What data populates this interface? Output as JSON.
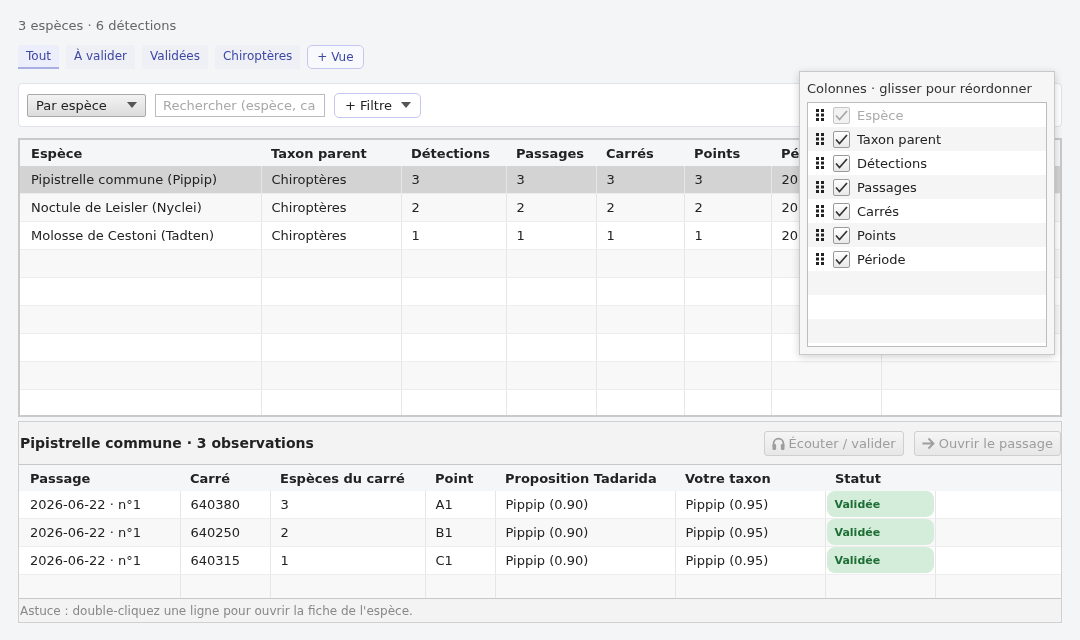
{
  "summary": "3 espèces · 6 détections",
  "tabs": [
    {
      "label": "Tout",
      "selected": true
    },
    {
      "label": "À valider",
      "selected": false
    },
    {
      "label": "Validées",
      "selected": false
    },
    {
      "label": "Chiroptères",
      "selected": false
    }
  ],
  "add_view_button": "+ Vue",
  "toolbar": {
    "group_by": "Par espèce",
    "search": {
      "placeholder": "Rechercher (espèce, ca"
    },
    "filter_button": "+ Filtre"
  },
  "species_table": {
    "columns": [
      "Espèce",
      "Taxon parent",
      "Détections",
      "Passages",
      "Carrés",
      "Points",
      "Pé"
    ],
    "rows": [
      {
        "cells": [
          "Pipistrelle commune (Pippip)",
          "Chiroptères",
          "3",
          "3",
          "3",
          "3",
          "20"
        ],
        "selected": true
      },
      {
        "cells": [
          "Noctule de Leisler (Nyclei)",
          "Chiroptères",
          "2",
          "2",
          "2",
          "2",
          "20"
        ],
        "selected": false
      },
      {
        "cells": [
          "Molosse de Cestoni (Tadten)",
          "Chiroptères",
          "1",
          "1",
          "1",
          "1",
          "20"
        ],
        "selected": false
      }
    ]
  },
  "detail": {
    "title": "Pipistrelle commune · 3 observations",
    "listen_button": {
      "label": "Écouter / valider",
      "disabled": true
    },
    "open_button": {
      "label": "Ouvrir le passage",
      "disabled": true
    },
    "columns": [
      "Passage",
      "Carré",
      "Espèces du carré",
      "Point",
      "Proposition Tadarida",
      "Votre taxon",
      "Statut"
    ],
    "rows": [
      {
        "cells": [
          "2026-06-22 · n°1",
          "640380",
          "3",
          "A1",
          "Pippip (0.90)",
          "Pippip (0.95)"
        ],
        "status": "Validée"
      },
      {
        "cells": [
          "2026-06-22 · n°1",
          "640250",
          "2",
          "B1",
          "Pippip (0.90)",
          "Pippip (0.95)"
        ],
        "status": "Validée"
      },
      {
        "cells": [
          "2026-06-22 · n°1",
          "640315",
          "1",
          "C1",
          "Pippip (0.90)",
          "Pippip (0.95)"
        ],
        "status": "Validée"
      }
    ]
  },
  "hint": "Astuce : double-cliquez une ligne pour ouvrir la fiche de l'espèce.",
  "columns_popup": {
    "title": "Colonnes · glisser pour réordonner",
    "items": [
      {
        "label": "Espèce",
        "checked": true,
        "disabled": true
      },
      {
        "label": "Taxon parent",
        "checked": true,
        "disabled": false
      },
      {
        "label": "Détections",
        "checked": true,
        "disabled": false
      },
      {
        "label": "Passages",
        "checked": true,
        "disabled": false
      },
      {
        "label": "Carrés",
        "checked": true,
        "disabled": false
      },
      {
        "label": "Points",
        "checked": true,
        "disabled": false
      },
      {
        "label": "Période",
        "checked": true,
        "disabled": false
      }
    ]
  }
}
